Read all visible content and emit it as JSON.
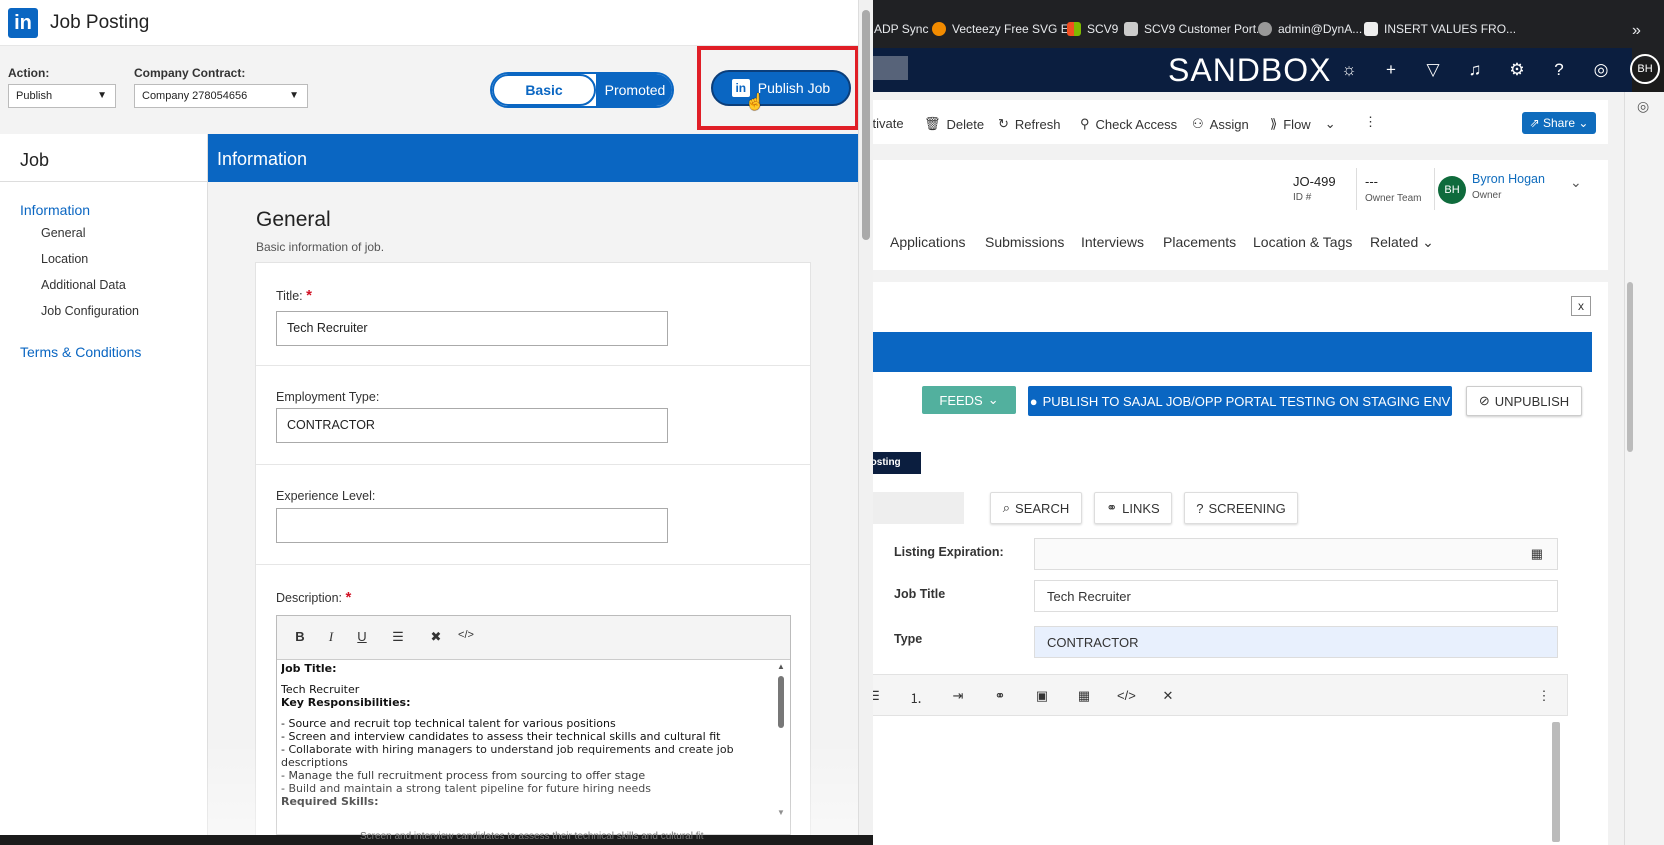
{
  "bookmarks": [
    "ADP Sync",
    "Vecteezy Free SVG E...",
    "SCV9",
    "SCV9 Customer Port...",
    "admin@DynA...",
    "INSERT VALUES FRO..."
  ],
  "crm": {
    "env_label": "SANDBOX",
    "avatar_initials": "BH",
    "commands": [
      "ctivate",
      "Delete",
      "Refresh",
      "Check Access",
      "Assign",
      "Flow"
    ],
    "share_label": "Share",
    "record_id": "JO-499",
    "record_id_label": "ID #",
    "owner_team": "---",
    "owner_team_label": "Owner Team",
    "owner_name": "Byron Hogan",
    "owner_label": "Owner",
    "owner_initials": "BH",
    "tabs": [
      "Applications",
      "Submissions",
      "Interviews",
      "Placements",
      "Location & Tags",
      "Related"
    ],
    "close_x": "x",
    "feeds_label": "FEEDS",
    "publish_portal_label": "PUBLISH TO SAJAL JOB/OPP PORTAL TESTING ON STAGING ENV",
    "unpublish_label": "UNPUBLISH",
    "posting_badge": "Posting",
    "search_label": "SEARCH",
    "links_label": "LINKS",
    "screening_label": "SCREENING",
    "listing_expiration_label": "Listing Expiration:",
    "job_title_label": "Job Title",
    "job_title_value": "Tech Recruiter",
    "type_label": "Type",
    "type_value": "CONTRACTOR"
  },
  "modal": {
    "title": "Job Posting",
    "logo_text": "in",
    "action_label": "Action:",
    "action_value": "Publish",
    "contract_label": "Company Contract:",
    "contract_value": "Company 278054656",
    "toggle_basic": "Basic",
    "toggle_promoted": "Promoted",
    "publish_label": "Publish Job",
    "sidebar": {
      "heading": "Job",
      "items": [
        {
          "label": "Information",
          "level": 0,
          "active": true
        },
        {
          "label": "General",
          "level": 1
        },
        {
          "label": "Location",
          "level": 1
        },
        {
          "label": "Additional Data",
          "level": 1
        },
        {
          "label": "Job Configuration",
          "level": 1
        },
        {
          "label": "Terms & Conditions",
          "level": 0,
          "active": true
        }
      ]
    },
    "section_header": "Information",
    "section_title": "General",
    "section_subtitle": "Basic information of job.",
    "fields": {
      "title_label": "Title:",
      "title_value": "Tech Recruiter",
      "employment_label": "Employment Type:",
      "employment_value": "CONTRACTOR",
      "experience_label": "Experience Level:",
      "experience_value": "",
      "description_label": "Description:",
      "required_mark": "*"
    },
    "editor_lines": [
      {
        "t": "Job Title:",
        "b": true
      },
      {
        "t": "",
        "b": false
      },
      {
        "t": "Tech Recruiter",
        "b": false
      },
      {
        "t": "Key Responsibilities:",
        "b": true
      },
      {
        "t": "",
        "b": false
      },
      {
        "t": "- Source and recruit top technical talent for various positions",
        "b": false
      },
      {
        "t": "- Screen and interview candidates to assess their technical skills and cultural fit",
        "b": false
      },
      {
        "t": "- Collaborate with hiring managers to understand job requirements and create job",
        "b": false
      },
      {
        "t": "descriptions",
        "b": false
      },
      {
        "t": "- Manage the full recruitment process from sourcing to offer stage",
        "b": false
      },
      {
        "t": "- Build and maintain a strong talent pipeline for future hiring needs",
        "b": false
      },
      {
        "t": "Required Skills:",
        "b": true
      }
    ],
    "bottom_text": "Screen and interview candidates to assess their technical skills and cultural fit"
  }
}
